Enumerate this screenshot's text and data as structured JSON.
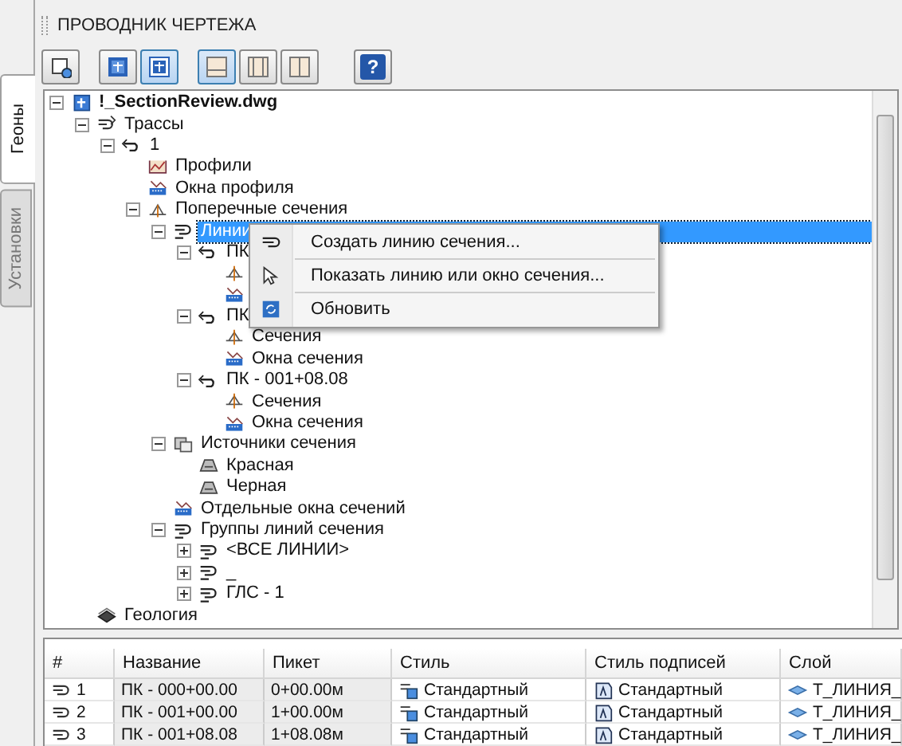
{
  "window": {
    "title": "ПРОВОДНИК ЧЕРТЕЖА"
  },
  "side_tabs": [
    {
      "label": "Геоны",
      "selected": true
    },
    {
      "label": "Установки",
      "selected": false
    }
  ],
  "toolbar": [
    {
      "kind": "drawing-settings",
      "pressed": false
    },
    {
      "kind": "tree-a",
      "pressed": false
    },
    {
      "kind": "tree-b",
      "pressed": true
    },
    {
      "kind": "panel-a",
      "pressed": true
    },
    {
      "kind": "panel-b",
      "pressed": false
    },
    {
      "kind": "panel-c",
      "pressed": false
    },
    {
      "kind": "help",
      "pressed": false,
      "label": "?"
    }
  ],
  "tree": [
    {
      "label": "!_SectionReview.dwg",
      "kind": "drawing",
      "bold": true,
      "expanded": true,
      "selected": false,
      "children": [
        {
          "label": "Трассы",
          "kind": "alignments",
          "expanded": true,
          "selected": false,
          "children": [
            {
              "label": "1",
              "kind": "alignment",
              "expanded": true,
              "selected": false,
              "children": [
                {
                  "label": "Профили",
                  "kind": "profiles",
                  "selected": false
                },
                {
                  "label": "Окна профиля",
                  "kind": "views",
                  "selected": false
                },
                {
                  "label": "Поперечные сечения",
                  "kind": "sections-group",
                  "expanded": true,
                  "selected": false,
                  "children": [
                    {
                      "label": "Линии",
                      "kind": "sample-lines",
                      "expanded": true,
                      "selected": true,
                      "children": [
                        {
                          "label": "ПК",
                          "kind": "alignment",
                          "expanded": true,
                          "selected": false,
                          "children": [
                            {
                              "kind": "sections",
                              "selected": false
                            },
                            {
                              "kind": "views",
                              "selected": false
                            }
                          ]
                        },
                        {
                          "label": "ПК",
                          "kind": "alignment",
                          "expanded": true,
                          "selected": false,
                          "children": [
                            {
                              "label": "Сечения",
                              "kind": "sections",
                              "selected": false
                            },
                            {
                              "label": "Окна сечения",
                              "kind": "views",
                              "selected": false
                            }
                          ]
                        },
                        {
                          "label": "ПК - 001+08.08",
                          "kind": "alignment",
                          "expanded": true,
                          "selected": false,
                          "children": [
                            {
                              "label": "Сечения",
                              "kind": "sections",
                              "selected": false
                            },
                            {
                              "label": "Окна сечения",
                              "kind": "views",
                              "selected": false
                            }
                          ]
                        }
                      ]
                    },
                    {
                      "label": "Источники сечения",
                      "kind": "sources",
                      "expanded": true,
                      "selected": false,
                      "children": [
                        {
                          "label": "Красная",
                          "kind": "surface",
                          "selected": false
                        },
                        {
                          "label": "Черная",
                          "kind": "surface",
                          "selected": false
                        }
                      ]
                    },
                    {
                      "label": "Отдельные окна сечений",
                      "kind": "views",
                      "selected": false
                    },
                    {
                      "label": "Группы линий сечения",
                      "kind": "sample-lines",
                      "expanded": true,
                      "selected": false,
                      "children": [
                        {
                          "label": "<ВСЕ ЛИНИИ>",
                          "kind": "sample-lines",
                          "expanded": false,
                          "selected": false
                        },
                        {
                          "label": "_",
                          "kind": "sample-lines",
                          "expanded": false,
                          "selected": false
                        },
                        {
                          "label": "ГЛС - 1",
                          "kind": "sample-lines",
                          "expanded": false,
                          "selected": false
                        }
                      ]
                    }
                  ]
                }
              ]
            }
          ]
        },
        {
          "label": "Геология",
          "kind": "geology",
          "selected": false
        }
      ]
    }
  ],
  "context_menu": [
    {
      "label": "Создать линию сечения...",
      "kind": "sample-line"
    },
    {
      "label": "Показать линию или окно сечения...",
      "kind": "pointer"
    },
    {
      "label": "Обновить",
      "kind": "refresh"
    }
  ],
  "table": {
    "columns": [
      {
        "label": "#",
        "kind": "number",
        "editable": true
      },
      {
        "label": "Название",
        "kind": "text",
        "editable": false
      },
      {
        "label": "Пикет",
        "kind": "text",
        "editable": false
      },
      {
        "label": "Стиль",
        "kind": "style",
        "editable": true
      },
      {
        "label": "Стиль подписей",
        "kind": "label-style",
        "editable": true
      },
      {
        "label": "Слой",
        "kind": "layer",
        "editable": true
      }
    ],
    "rows": [
      [
        "1",
        "ПК - 000+00.00",
        "0+00.00м",
        "Стандартный",
        "Стандартный",
        "Т_ЛИНИЯ_"
      ],
      [
        "2",
        "ПК - 001+00.00",
        "1+00.00м",
        "Стандартный",
        "Стандартный",
        "Т_ЛИНИЯ_"
      ],
      [
        "3",
        "ПК - 001+08.08",
        "1+08.08м",
        "Стандартный",
        "Стандартный",
        "Т_ЛИНИЯ_"
      ]
    ]
  }
}
